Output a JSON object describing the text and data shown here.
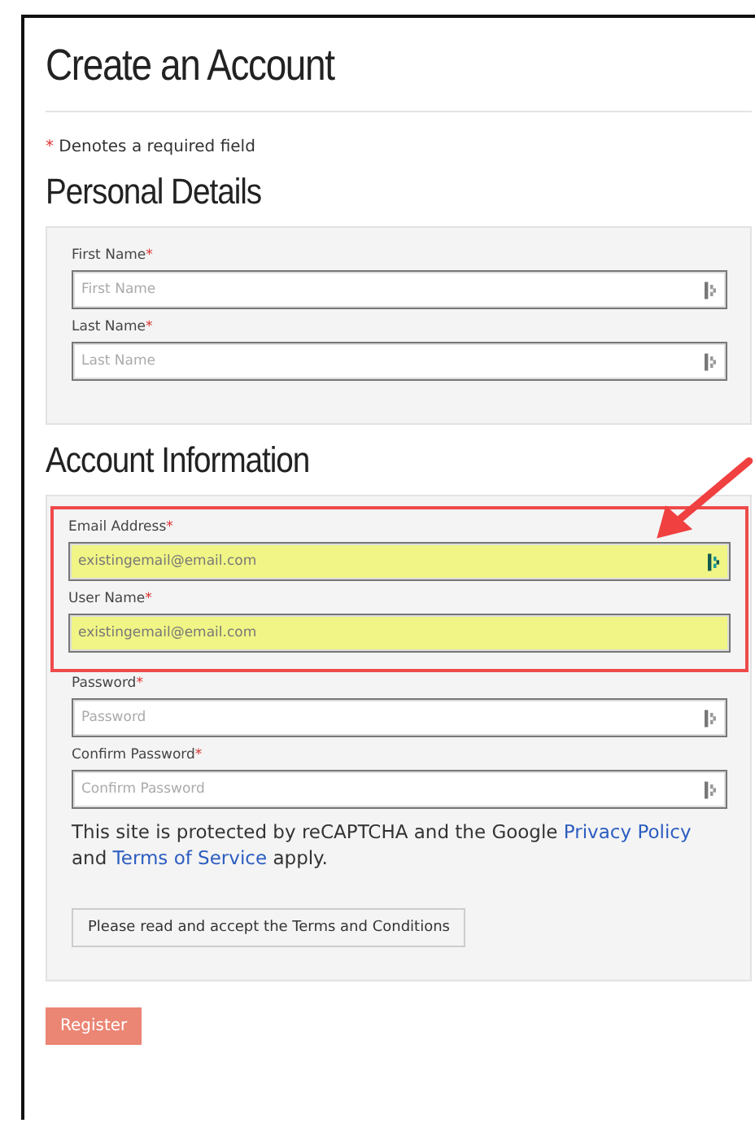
{
  "title": "Create an Account",
  "required_note": {
    "marker": "*",
    "text": "Denotes a required field"
  },
  "sections": [
    {
      "heading": "Personal Details",
      "fields": [
        {
          "label": "First Name",
          "marker": "*",
          "placeholder": "First Name",
          "autofilled": false,
          "annotated": false,
          "manager_icon": true
        },
        {
          "label": "Last Name",
          "marker": "*",
          "placeholder": "Last Name",
          "autofilled": false,
          "annotated": false,
          "manager_icon": true
        }
      ]
    },
    {
      "heading": "Account Information",
      "fields": [
        {
          "label": "Email Address",
          "marker": "*",
          "value": "existingemail@email.com",
          "autofilled": true,
          "annotated": true,
          "manager_icon": true
        },
        {
          "label": "User Name",
          "marker": "*",
          "value": "existingemail@email.com",
          "autofilled": true,
          "annotated": true,
          "manager_icon": false
        },
        {
          "label": "Password",
          "marker": "*",
          "placeholder": "Password",
          "autofilled": false,
          "annotated": false,
          "manager_icon": true
        },
        {
          "label": "Confirm Password",
          "marker": "*",
          "placeholder": "Confirm Password",
          "autofilled": false,
          "annotated": false,
          "manager_icon": true
        }
      ],
      "notice": {
        "before": "This site is protected by reCAPTCHA and the Google ",
        "link1": "Privacy Policy",
        "middle": " and ",
        "link2": "Terms of Service",
        "after": " apply."
      },
      "terms_button": "Please read and accept the Terms and Conditions"
    }
  ],
  "register_button": "Register",
  "annotation_arrow": true
}
